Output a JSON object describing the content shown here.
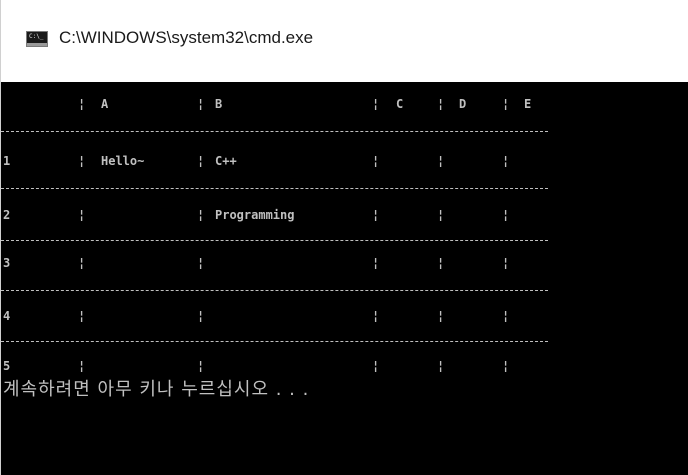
{
  "window": {
    "title": "C:\\WINDOWS\\system32\\cmd.exe",
    "icon": "cmd-icon",
    "icon_glyph": "C:\\_"
  },
  "table": {
    "separator": "¦",
    "columns": [
      "A",
      "B",
      "C",
      "D",
      "E"
    ],
    "rows": [
      {
        "index": "1",
        "cells": [
          "Hello~",
          "C++",
          "",
          "",
          ""
        ]
      },
      {
        "index": "2",
        "cells": [
          "",
          "Programming",
          "",
          "",
          ""
        ]
      },
      {
        "index": "3",
        "cells": [
          "",
          "",
          "",
          "",
          ""
        ]
      },
      {
        "index": "4",
        "cells": [
          "",
          "",
          "",
          "",
          ""
        ]
      },
      {
        "index": "5",
        "cells": [
          "",
          "",
          "",
          "",
          ""
        ]
      }
    ]
  },
  "prompt": "계속하려면 아무 키나 누르십시오 . . .",
  "colors": {
    "background": "#000000",
    "text": "#c0c0c0",
    "titlebar": "#ffffff"
  }
}
